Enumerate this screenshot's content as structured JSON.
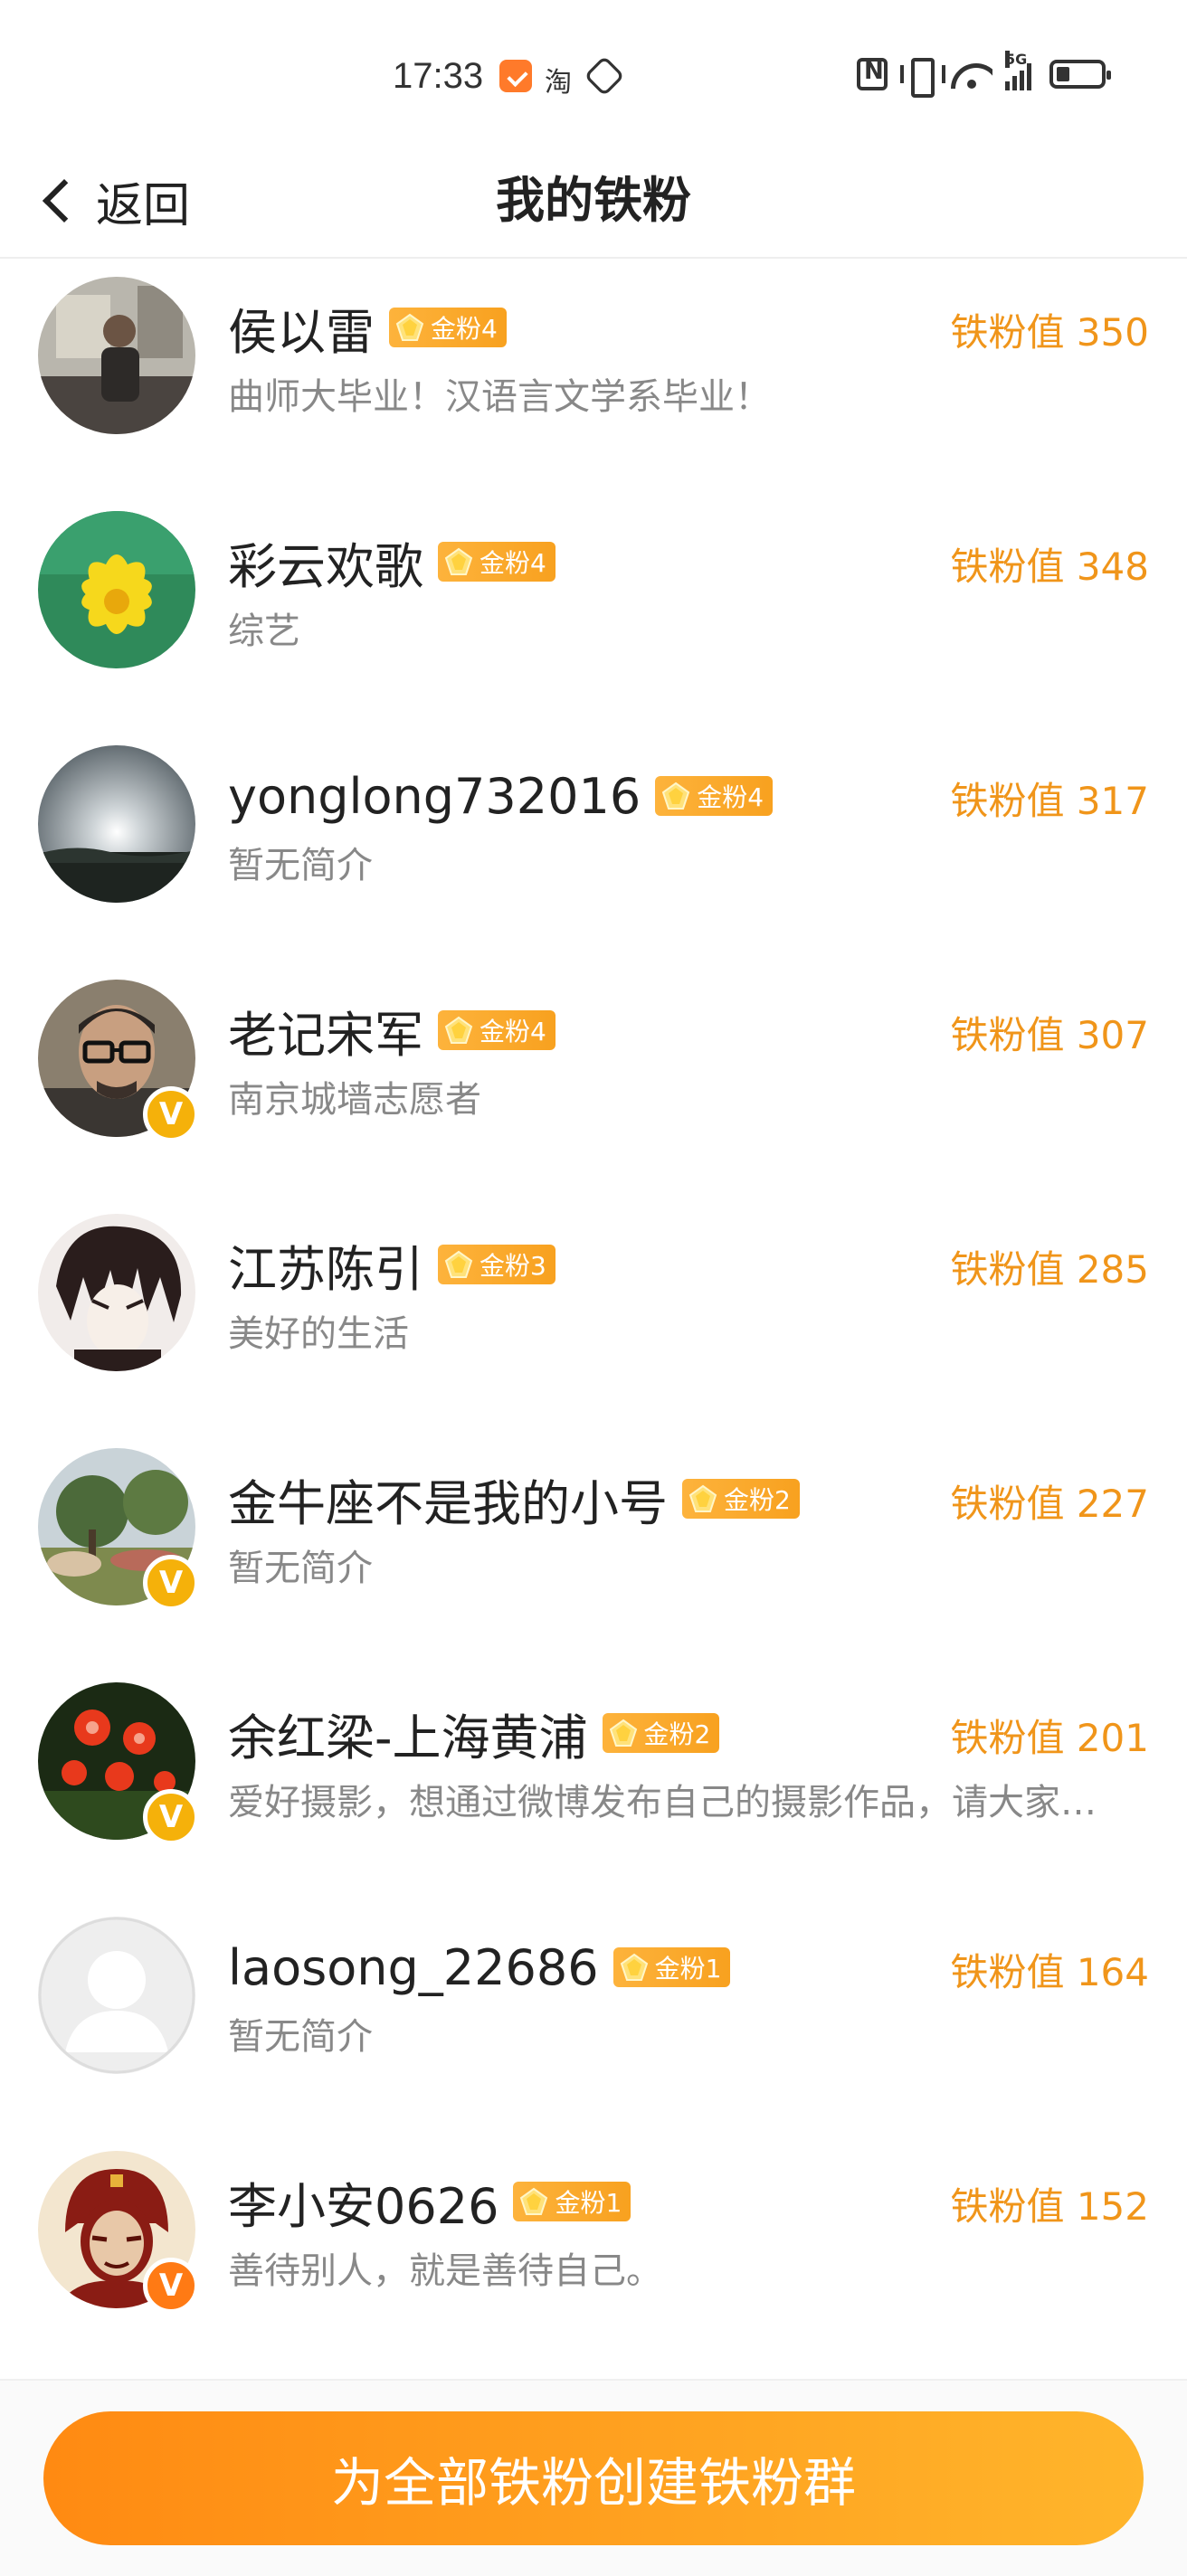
{
  "status_bar": {
    "time": "17:33",
    "taobao_glyph": "淘",
    "network": "5G"
  },
  "header": {
    "back_label": "返回",
    "title": "我的铁粉"
  },
  "fans": [
    {
      "name": "侯以雷",
      "badge": "金粉4",
      "bio": "曲师大毕业！汉语言文学系毕业！",
      "score": "铁粉值 350",
      "verified": "none",
      "avatar": "portrait-man"
    },
    {
      "name": "彩云欢歌",
      "badge": "金粉4",
      "bio": "综艺",
      "score": "铁粉值 348",
      "verified": "none",
      "avatar": "yellow-flower"
    },
    {
      "name": "yonglong732016",
      "badge": "金粉4",
      "bio": "暂无简介",
      "score": "铁粉值 317",
      "verified": "none",
      "avatar": "sunset-sky"
    },
    {
      "name": "老记宋军",
      "badge": "金粉4",
      "bio": "南京城墙志愿者",
      "score": "铁粉值 307",
      "verified": "gold",
      "avatar": "glasses-man"
    },
    {
      "name": "江苏陈引",
      "badge": "金粉3",
      "bio": "美好的生活",
      "score": "铁粉值 285",
      "verified": "none",
      "avatar": "anime-boy"
    },
    {
      "name": "金牛座不是我的小号",
      "badge": "金粉2",
      "bio": "暂无简介",
      "score": "铁粉值 227",
      "verified": "gold",
      "avatar": "park-trees"
    },
    {
      "name": "余红梁-上海黄浦",
      "badge": "金粉2",
      "bio": "爱好摄影，想通过微博发布自己的摄影作品，请大家…",
      "score": "铁粉值 201",
      "verified": "gold",
      "avatar": "red-flowers"
    },
    {
      "name": "laosong_22686",
      "badge": "金粉1",
      "bio": "暂无简介",
      "score": "铁粉值 164",
      "verified": "none",
      "avatar": "default-user"
    },
    {
      "name": "李小安0626",
      "badge": "金粉1",
      "bio": "善待别人，就是善待自己。",
      "score": "铁粉值 152",
      "verified": "orange",
      "avatar": "red-portrait"
    }
  ],
  "footer": {
    "create_group_label": "为全部铁粉创建铁粉群"
  },
  "colors": {
    "accent": "#f0951a",
    "badge": "#fdb33c",
    "button_start": "#ff8a12",
    "button_end": "#ffb52b",
    "verified_gold": "#f5b10a",
    "verified_orange": "#ff7a14"
  }
}
